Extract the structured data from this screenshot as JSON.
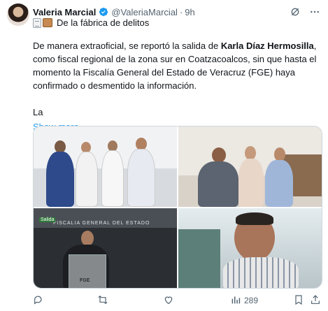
{
  "author": {
    "name": "Valeria Marcial",
    "handle": "@ValeriaMarcial",
    "separator": "·",
    "time": "9h"
  },
  "subtitle": "De la fábrica de delitos",
  "tweet": {
    "part1": "De manera extraoficial, se reportó la salida de ",
    "bold": "Karla Díaz Hermosilla",
    "part2": ", como fiscal regional de la zona sur en Coatzacoalcos, sin que hasta el momento la Fiscalía General del Estado de Veracruz (FGE) haya confirmado o desmentido la información.",
    "trailing": "La",
    "show_more": "Show more"
  },
  "photo3": {
    "sign": "FISCALIA GENERAL DEL ESTADO",
    "exit": "Salida",
    "podium": "FGE"
  },
  "actions": {
    "views": "289"
  },
  "colors": {
    "accent": "#1d9bf0",
    "muted": "#536471"
  }
}
